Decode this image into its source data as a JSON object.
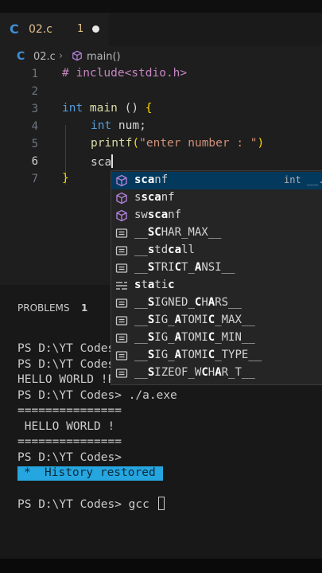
{
  "tab": {
    "icon": "C",
    "name": "02.c",
    "problem_count": "1"
  },
  "breadcrumb": {
    "icon": "C",
    "file": "02.c",
    "separator": "›",
    "symbol": "main()"
  },
  "editor": {
    "line_numbers": [
      "1",
      "2",
      "3",
      "4",
      "5",
      "6",
      "7"
    ],
    "lines": {
      "l1_pp": "# include<stdio.h>",
      "l3_kw": "int",
      "l3_fn": " main ",
      "l3_paren": "() ",
      "l3_brace": "{",
      "l4_kw": "int",
      "l4_rest": " num;",
      "l5_fn": "printf",
      "l5_open": "(",
      "l5_str": "\"enter number : \"",
      "l5_close": ")",
      "l6_text": "sca",
      "l7_brace": "}"
    }
  },
  "suggestions": [
    {
      "pre": "",
      "hl": "sca",
      "post": "nf",
      "icon": "cube-icon",
      "detail": "int __..."
    },
    {
      "pre": "s",
      "hl": "sca",
      "post": "nf",
      "icon": "cube-icon",
      "detail": ""
    },
    {
      "pre": "sw",
      "hl": "sca",
      "post": "nf",
      "icon": "cube-icon",
      "detail": ""
    },
    {
      "pre": "__",
      "hl": "SC",
      "post": "HAR_MAX__",
      "icon": "constant-icon",
      "detail": ""
    },
    {
      "pre": "__",
      "hl": "s",
      "post": "td",
      "hl2": "ca",
      "post2": "ll",
      "icon": "constant-icon",
      "detail": ""
    },
    {
      "pre": "__",
      "hl": "S",
      "post": "TRI",
      "hl2": "C",
      "post2": "T_",
      "hl3": "A",
      "post3": "NSI__",
      "icon": "constant-icon",
      "detail": ""
    },
    {
      "pre": "",
      "hl": "s",
      "post": "t",
      "hl2": "a",
      "post2": "ti",
      "hl3": "c",
      "post3": "",
      "icon": "keyword-icon",
      "detail": ""
    },
    {
      "pre": "__",
      "hl": "S",
      "post": "IGNED_",
      "hl2": "C",
      "post2": "H",
      "hl3": "A",
      "post3": "RS__",
      "icon": "constant-icon",
      "detail": ""
    },
    {
      "pre": "__",
      "hl": "S",
      "post": "IG_",
      "hl2": "A",
      "post2": "TOMI",
      "hl3": "C",
      "post3": "_MAX__",
      "icon": "constant-icon",
      "detail": ""
    },
    {
      "pre": "__",
      "hl": "S",
      "post": "IG_",
      "hl2": "A",
      "post2": "TOMI",
      "hl3": "C",
      "post3": "_MIN__",
      "icon": "constant-icon",
      "detail": ""
    },
    {
      "pre": "__",
      "hl": "S",
      "post": "IG_",
      "hl2": "A",
      "post2": "TOMI",
      "hl3": "C",
      "post3": "_TYPE__",
      "icon": "constant-icon",
      "detail": ""
    },
    {
      "pre": "__",
      "hl": "S",
      "post": "IZEOF_W",
      "hl2": "C",
      "post2": "H",
      "hl3": "A",
      "post3": "R_T__",
      "icon": "constant-icon",
      "detail": ""
    }
  ],
  "panel": {
    "problems_label": "PROBLEMS",
    "problems_count": "1"
  },
  "terminal": {
    "line1": "PS D:\\YT Codes",
    "line2": "PS D:\\YT Codes",
    "line3": "HELLO WORLD !P",
    "line4": "PS D:\\YT Codes> ./a.exe",
    "line5": "===============",
    "line6": " HELLO WORLD !",
    "line7": "===============",
    "line8": "PS D:\\YT Codes>",
    "history_star": "*",
    "history_text": "History restored",
    "prompt": "PS D:\\YT Codes> gcc "
  },
  "colors": {
    "accent": "#26a6e0",
    "c_icon": "#3e8fd6",
    "modified": "#e2c08d"
  }
}
